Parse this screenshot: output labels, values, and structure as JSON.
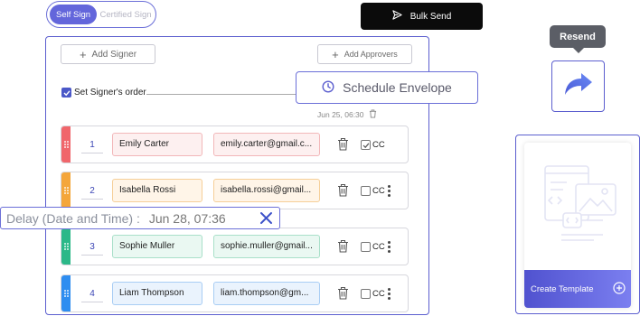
{
  "mode_toggle": {
    "self_sign": "Self Sign",
    "certified_sign": "Certified Sign"
  },
  "bulk_send": {
    "label": "Bulk Send"
  },
  "main": {
    "add_signer": "Add Signer",
    "add_approvers": "Add Approvers",
    "signers_order_label": "Set Signer's order",
    "signers_order_checked": true,
    "schedule_meta": "Jun 25, 06:30",
    "signers": [
      {
        "order": "1",
        "name": "Emily Carter",
        "email": "emily.carter@gmail.c...",
        "cc_label": "CC",
        "cc_checked": true,
        "color": "#f0666b",
        "name_bg": "#fdf0f0",
        "name_border": "#f2b7b9",
        "email_bg": "#fdf0f0",
        "email_border": "#f2b7b9"
      },
      {
        "order": "2",
        "name": "Isabella Rossi",
        "email": "isabella.rossi@gmail...",
        "cc_label": "CC",
        "cc_checked": false,
        "color": "#f4a63b",
        "name_bg": "#fff5e8",
        "name_border": "#f6cf98",
        "email_bg": "#fff5e8",
        "email_border": "#f6cf98"
      },
      {
        "order": "3",
        "name": "Sophie Muller",
        "email": "sophie.muller@gmail...",
        "cc_label": "CC",
        "cc_checked": false,
        "color": "#2bb888",
        "name_bg": "#eaf8f2",
        "name_border": "#a9e0c9",
        "email_bg": "#eaf8f2",
        "email_border": "#a9e0c9"
      },
      {
        "order": "4",
        "name": "Liam Thompson",
        "email": "liam.thompson@gm...",
        "cc_label": "CC",
        "cc_checked": false,
        "color": "#2e8df0",
        "name_bg": "#eaf3fd",
        "name_border": "#a8cdf4",
        "email_bg": "#eaf3fd",
        "email_border": "#a8cdf4"
      }
    ]
  },
  "schedule_envelope": {
    "label": "Schedule Envelope"
  },
  "delay": {
    "label": "Delay (Date and Time) :",
    "value": "Jun 28, 07:36"
  },
  "resend": {
    "label": "Resend"
  },
  "template": {
    "label": "Create Template"
  },
  "colors": {
    "accent": "#5c5fcf",
    "toggle_active": "#6366db",
    "delay_close": "#3d52c9"
  },
  "icons": [
    "send-icon",
    "plus-icon",
    "clock-icon",
    "trash-icon",
    "drag-handle-icon",
    "kebab-icon",
    "close-icon",
    "resend-arrow-icon",
    "template-illustration",
    "plus-circle-icon"
  ]
}
